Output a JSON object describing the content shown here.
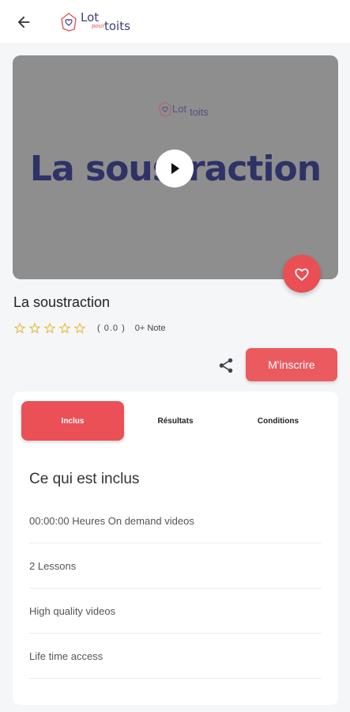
{
  "appbar": {
    "logo": {
      "lot": "Lot",
      "pour": "pour",
      "toits": "toits"
    }
  },
  "video": {
    "logo": {
      "lot": "Lot",
      "toits": "toits"
    },
    "title": "La soustraction"
  },
  "course": {
    "title": "La soustraction",
    "rating": {
      "stars": 0,
      "max": 5,
      "count_text": "( 0.0 )",
      "note_text": "0+ Note"
    }
  },
  "actions": {
    "enroll_label": "M'inscrire"
  },
  "tabs": [
    {
      "label": "Inclus",
      "active": true
    },
    {
      "label": "Résultats",
      "active": false
    },
    {
      "label": "Conditions",
      "active": false
    }
  ],
  "included": {
    "title": "Ce qui est inclus",
    "items": [
      "00:00:00 Heures On demand videos",
      "2 Lessons",
      "High quality videos",
      "Life time access"
    ]
  },
  "colors": {
    "accent": "#ea5a5e",
    "brand_blue": "#3b3f7a",
    "star": "#e7b93a"
  }
}
